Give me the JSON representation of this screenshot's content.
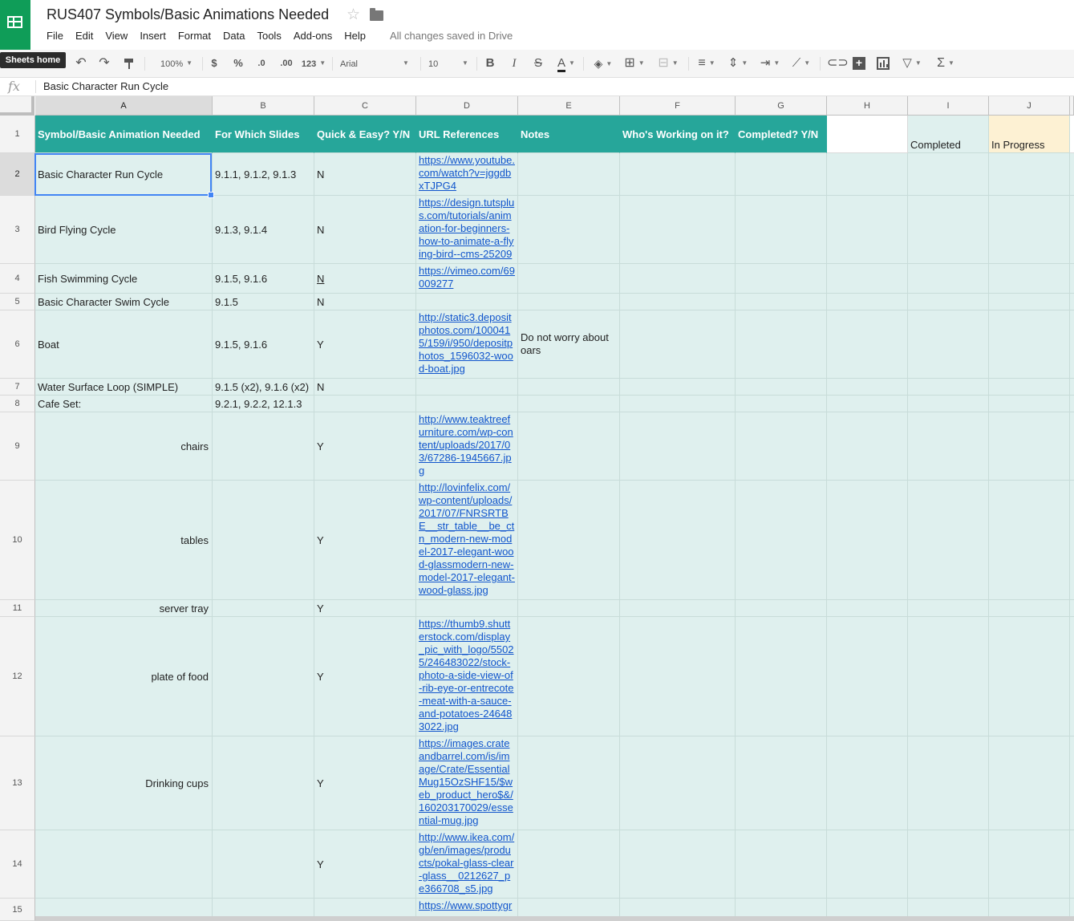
{
  "doc": {
    "title": "RUS407 Symbols/Basic Animations Needed",
    "save_status": "All changes saved in Drive",
    "home_tooltip": "Sheets home"
  },
  "menu": [
    "File",
    "Edit",
    "View",
    "Insert",
    "Format",
    "Data",
    "Tools",
    "Add-ons",
    "Help"
  ],
  "toolbar": {
    "zoom": "100%",
    "currency": "$",
    "percent": "%",
    "decrease_decimal": ".0",
    "increase_decimal": ".00",
    "more_formats": "123",
    "font": "Arial",
    "font_size": "10",
    "bold": "B",
    "italic": "I",
    "strike": "S",
    "text_color": "A",
    "functions": "Σ"
  },
  "formula_bar": {
    "fx": "fx",
    "content": "Basic Character Run Cycle"
  },
  "columns": [
    "A",
    "B",
    "C",
    "D",
    "E",
    "F",
    "G",
    "H",
    "I",
    "J"
  ],
  "header_row": {
    "a": "Symbol/Basic Animation Needed",
    "b": "For Which Slides",
    "c": "Quick & Easy? Y/N",
    "d": "URL References",
    "e": "Notes",
    "f": "Who's Working on it?",
    "g": "Completed? Y/N",
    "h": "",
    "i": "Completed",
    "j": "In Progress"
  },
  "rows": [
    {
      "num": "1"
    },
    {
      "num": "2",
      "a": "Basic Character Run Cycle",
      "b": "9.1.1, 9.1.2, 9.1.3",
      "c": "N",
      "d": "https://www.youtube.com/watch?v=jggdbxTJPG4"
    },
    {
      "num": "3",
      "a": "Bird Flying Cycle",
      "b": "9.1.3, 9.1.4",
      "c": "N",
      "d": "https://design.tutsplus.com/tutorials/animation-for-beginners-how-to-animate-a-flying-bird--cms-25209"
    },
    {
      "num": "4",
      "a": "Fish Swimming Cycle",
      "b": "9.1.5, 9.1.6",
      "c": "N",
      "d": "https://vimeo.com/69009277"
    },
    {
      "num": "5",
      "a": "Basic Character Swim Cycle",
      "b": "9.1.5",
      "c": "N",
      "d": ""
    },
    {
      "num": "6",
      "a": "Boat",
      "b": "9.1.5, 9.1.6",
      "c": "Y",
      "d": "http://static3.depositphotos.com/1000415/159/i/950/depositphotos_1596032-wood-boat.jpg",
      "e": "Do not worry about oars"
    },
    {
      "num": "7",
      "a": "Water Surface Loop (SIMPLE)",
      "b": "9.1.5 (x2), 9.1.6 (x2)",
      "c": "N",
      "d": ""
    },
    {
      "num": "8",
      "a": "Cafe Set:",
      "b": "9.2.1, 9.2.2, 12.1.3",
      "c": "",
      "d": ""
    },
    {
      "num": "9",
      "a": "chairs",
      "b": "",
      "c": "Y",
      "d": "http://www.teaktreefurniture.com/wp-content/uploads/2017/03/67286-1945667.jpg"
    },
    {
      "num": "10",
      "a": "tables",
      "b": "",
      "c": "Y",
      "d": "http://lovinfelix.com/wp-content/uploads/2017/07/FNRSRTBE__str_table__be_ctn_modern-new-model-2017-elegant-wood-glassmodern-new-model-2017-elegant-wood-glass.jpg"
    },
    {
      "num": "11",
      "a": "server tray",
      "b": "",
      "c": "Y",
      "d": ""
    },
    {
      "num": "12",
      "a": "plate of food",
      "b": "",
      "c": "Y",
      "d": "https://thumb9.shutterstock.com/display_pic_with_logo/55025/246483022/stock-photo-a-side-view-of-rib-eye-or-entrecote-meat-with-a-sauce-and-potatoes-246483022.jpg"
    },
    {
      "num": "13",
      "a": "Drinking cups",
      "b": "",
      "c": "Y",
      "d": "https://images.crateandbarrel.com/is/image/Crate/EssentialMug15OzSHF15/$web_product_hero$&/160203170029/essential-mug.jpg"
    },
    {
      "num": "14",
      "a": "",
      "b": "",
      "c": "Y",
      "d": "http://www.ikea.com/gb/en/images/products/pokal-glass-clear-glass__0212627_pe366708_s5.jpg"
    },
    {
      "num": "15",
      "a": "",
      "b": "",
      "c": "",
      "d": "https://www.spottygr"
    }
  ],
  "colors": {
    "header_teal": "#26a69a",
    "row_fill": "#dff0ee",
    "in_progress_fill": "#fdf1d3",
    "brand_green": "#0f9d58",
    "link": "#1155cc",
    "selection": "#4285f4"
  }
}
